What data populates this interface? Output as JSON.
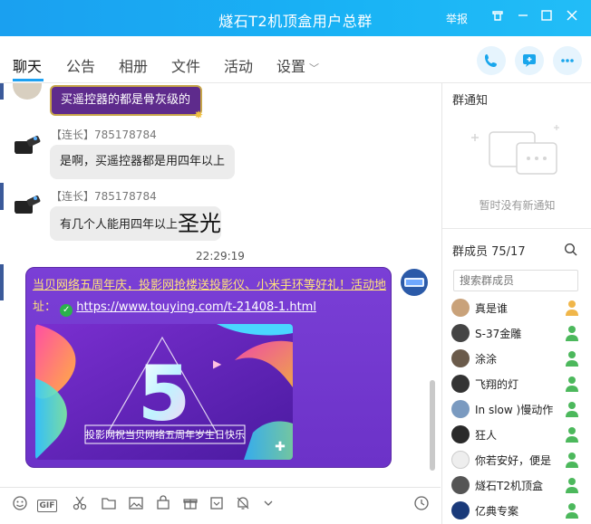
{
  "window": {
    "title": "燧石T2机顶盒用户总群",
    "report_label": "举报",
    "title_bar_color": "#1aa0f0"
  },
  "tabs": [
    {
      "label": "聊天",
      "active": true
    },
    {
      "label": "公告"
    },
    {
      "label": "相册"
    },
    {
      "label": "文件"
    },
    {
      "label": "活动"
    },
    {
      "label": "设置"
    }
  ],
  "header_actions": [
    "phone-icon",
    "share-screen-icon",
    "more-icon"
  ],
  "chat": {
    "messages": [
      {
        "type": "sticker-text",
        "text": "买遥控器的都是骨灰级的"
      },
      {
        "sender": "【连长】785178784",
        "text": "是啊，买遥控器都是用四年以上"
      },
      {
        "sender": "【连长】785178784",
        "text": "有几个人能用四年以上",
        "big_text": "圣光"
      }
    ],
    "timestamp": "22:29:19",
    "share": {
      "text_a": "当贝网络五周年庆，投影网抢楼送投影仪、小米手环等好礼！活动地",
      "text_b": "址：",
      "link": "https://www.touying.com/t-21408-1.html",
      "banner_caption": "投影网祝当贝网络五周年岁生日快乐",
      "banner_number": "5"
    }
  },
  "toolbar": [
    "emoji-icon",
    "gif-icon",
    "scissors-icon",
    "folder-icon",
    "image-icon",
    "gift-bag-icon",
    "gift-icon",
    "calendar-icon",
    "bell-off-icon",
    "history-icon"
  ],
  "gif_label": "GIF",
  "right_panel": {
    "notice_title": "群通知",
    "notice_empty": "暂时没有新通知",
    "members_title": "群成员 75/17",
    "search_placeholder": "搜索群成员",
    "members": [
      {
        "name": "真是谁",
        "role": "admin"
      },
      {
        "name": "S-37金雕",
        "role": "member"
      },
      {
        "name": "涂涂",
        "role": "member"
      },
      {
        "name": "飞翔的灯",
        "role": "member"
      },
      {
        "name": "In slow )慢动作",
        "role": "member"
      },
      {
        "name": "狂人",
        "role": "member"
      },
      {
        "name": "你若安好，便是",
        "role": "member"
      },
      {
        "name": "燧石T2机顶盒",
        "role": "member"
      },
      {
        "name": "亿典专案",
        "role": "member"
      }
    ]
  }
}
